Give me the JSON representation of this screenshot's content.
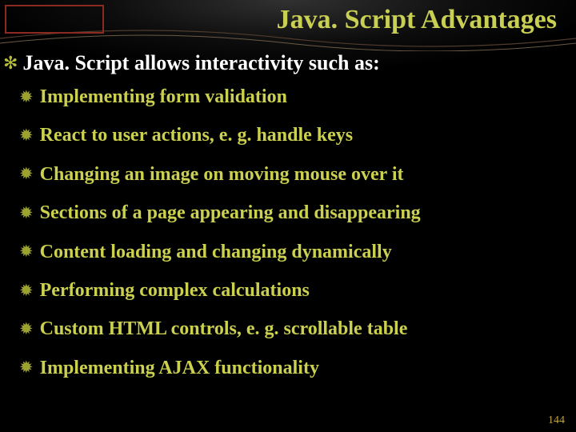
{
  "title": "Java. Script Advantages",
  "lead": "Java. Script allows interactivity such as:",
  "items": [
    "Implementing form validation",
    "React to user actions, e. g. handle keys",
    "Changing an image on moving mouse over it",
    "Sections of a page appearing and disappearing",
    "Content loading and changing dynamically",
    "Performing complex calculations",
    "Custom HTML controls, e. g. scrollable table",
    "Implementing AJAX functionality"
  ],
  "page_number": "144",
  "icons": {
    "asterisk": "✻",
    "burst": "✹"
  }
}
